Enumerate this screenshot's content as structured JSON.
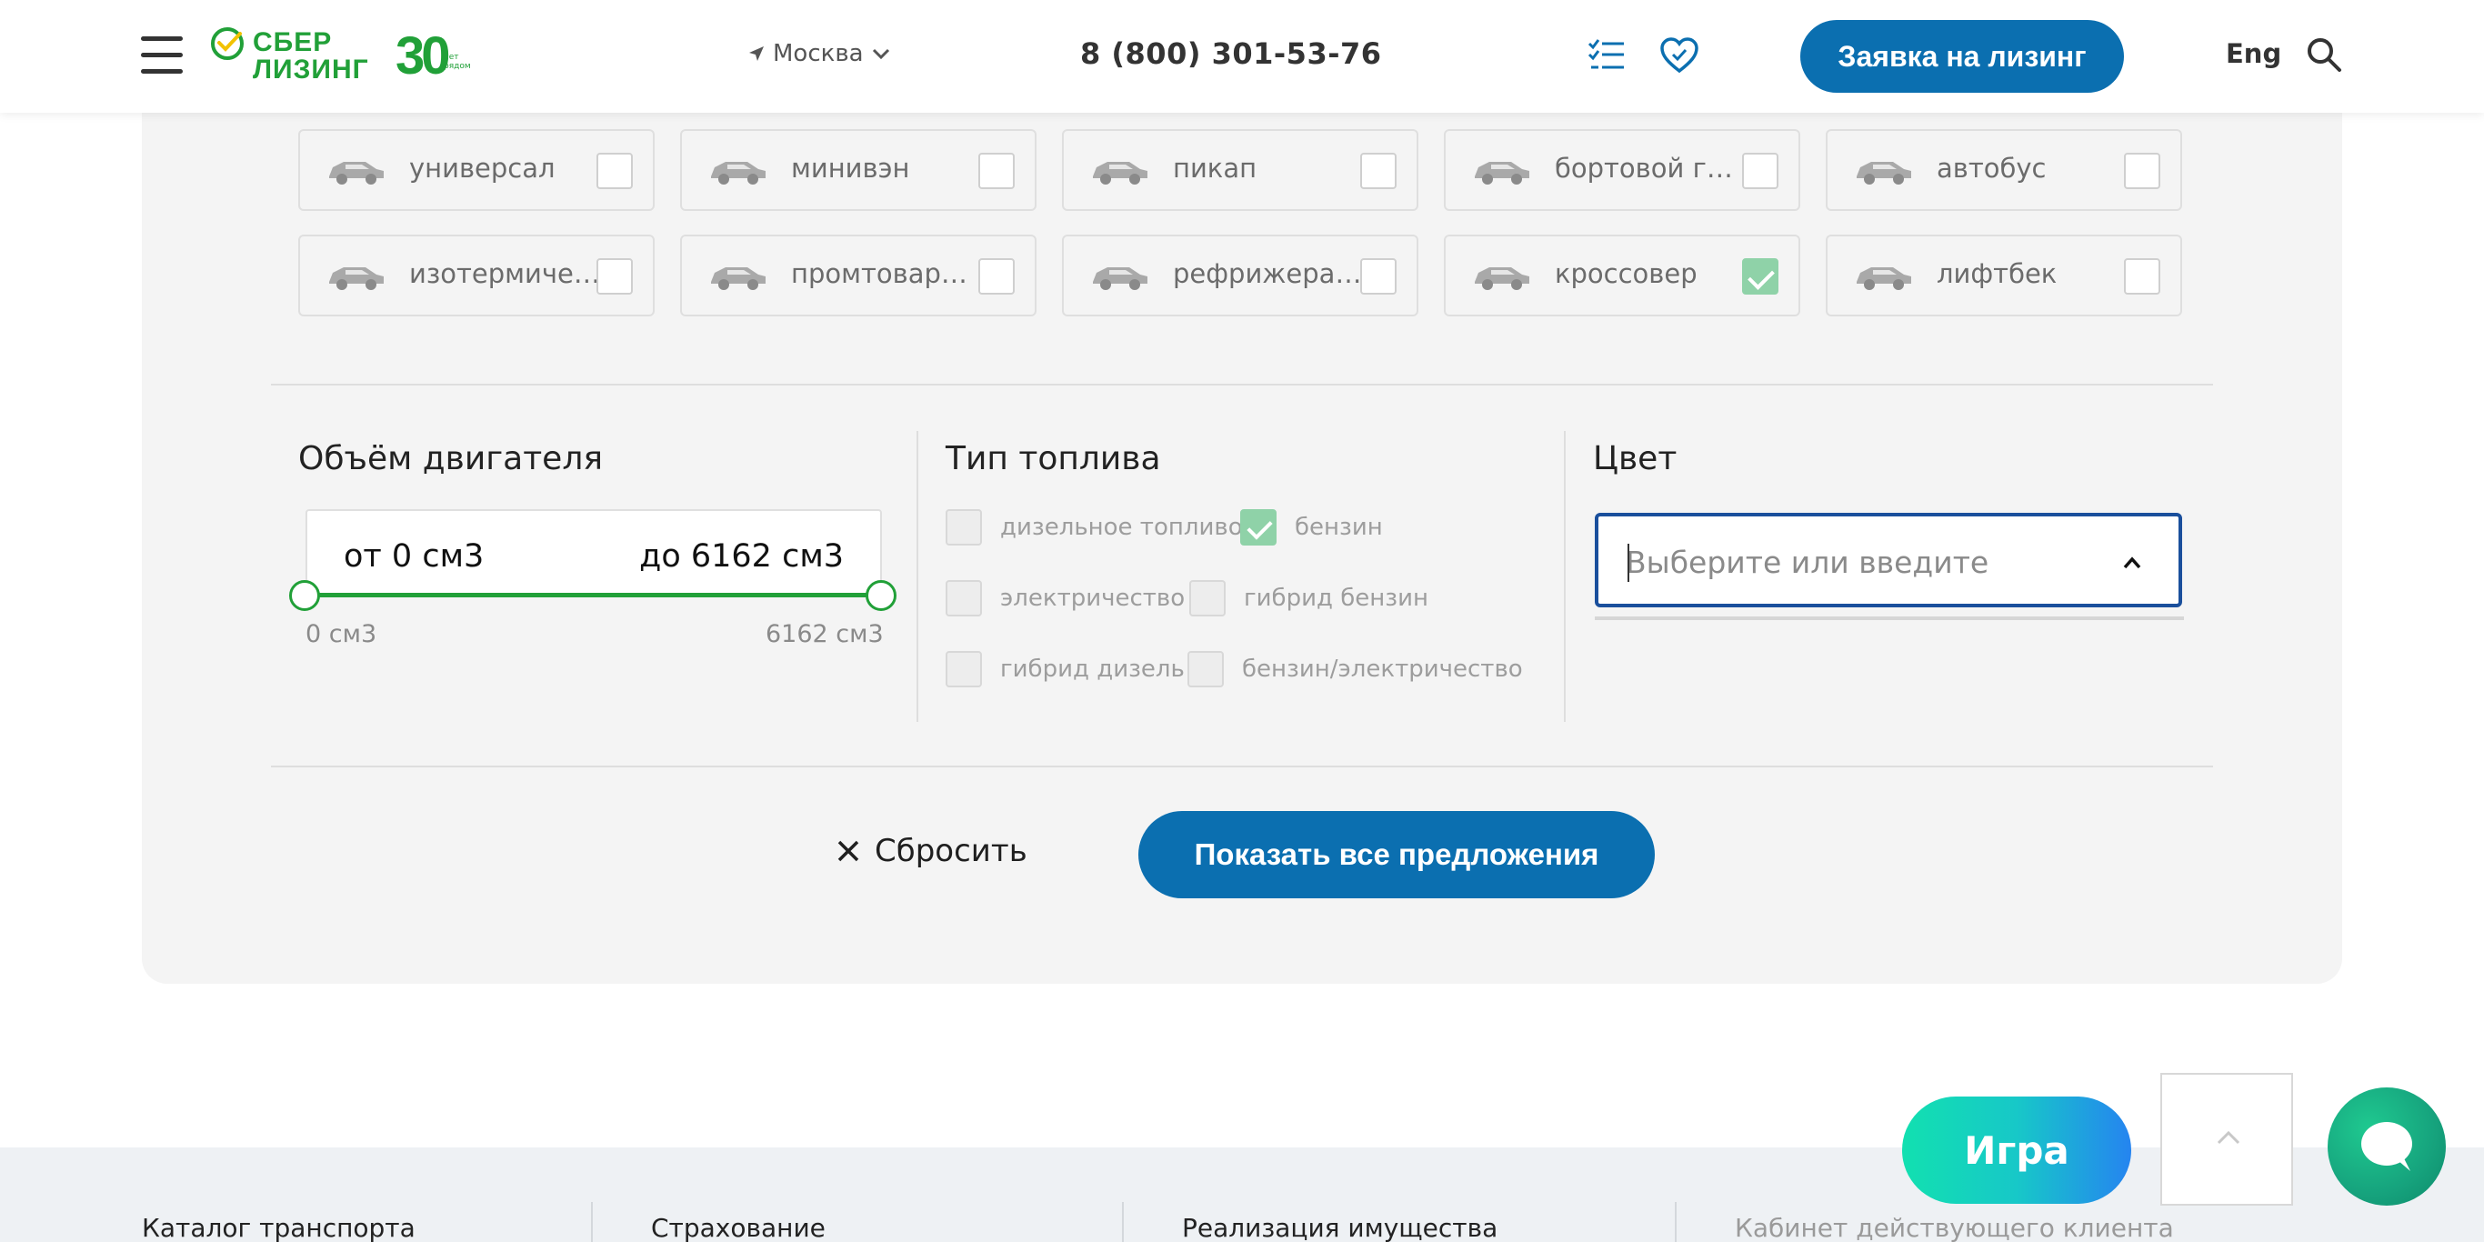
{
  "header": {
    "logo_line1": "СБЕР",
    "logo_line2": "ЛИЗИНГ",
    "logo_30": "30",
    "logo_sub": "лет рядом",
    "city": "Москва",
    "phone": "8 (800) 301-53-76",
    "lease_button": "Заявка на лизинг",
    "lang": "Eng"
  },
  "body_types": [
    {
      "label": "универсал",
      "checked": false
    },
    {
      "label": "минивэн",
      "checked": false
    },
    {
      "label": "пикап",
      "checked": false
    },
    {
      "label": "бортовой гру...",
      "checked": false
    },
    {
      "label": "автобус",
      "checked": false
    },
    {
      "label": "изотермическ...",
      "checked": false
    },
    {
      "label": "промтоварны...",
      "checked": false
    },
    {
      "label": "рефрижерат...",
      "checked": false
    },
    {
      "label": "кроссовер",
      "checked": true
    },
    {
      "label": "лифтбек",
      "checked": false
    }
  ],
  "engine": {
    "title": "Объём двигателя",
    "from_label": "от 0 см3",
    "to_label": "до 6162 см3",
    "min_label": "0 см3",
    "max_label": "6162 см3",
    "min": 0,
    "max": 6162,
    "value_from": 0,
    "value_to": 6162
  },
  "fuel": {
    "title": "Тип топлива",
    "options": [
      {
        "label": "дизельное топливо",
        "checked": false
      },
      {
        "label": "бензин",
        "checked": true
      },
      {
        "label": "электричество",
        "checked": false
      },
      {
        "label": "гибрид бензин",
        "checked": false
      },
      {
        "label": "гибрид дизель",
        "checked": false
      },
      {
        "label": "бензин/электричество",
        "checked": false
      }
    ]
  },
  "color": {
    "title": "Цвет",
    "placeholder": "Выберите или введите"
  },
  "actions": {
    "reset": "Сбросить",
    "show_all": "Показать все предложения"
  },
  "footer": {
    "links": [
      "Каталог транспорта",
      "Страхование",
      "Реализация имущества",
      "Кабинет действующего клиента"
    ]
  },
  "floating": {
    "game": "Игра"
  },
  "colors": {
    "brand_green": "#21a038",
    "primary_blue": "#0b6fb0",
    "focus_blue": "#1a4f9c"
  }
}
